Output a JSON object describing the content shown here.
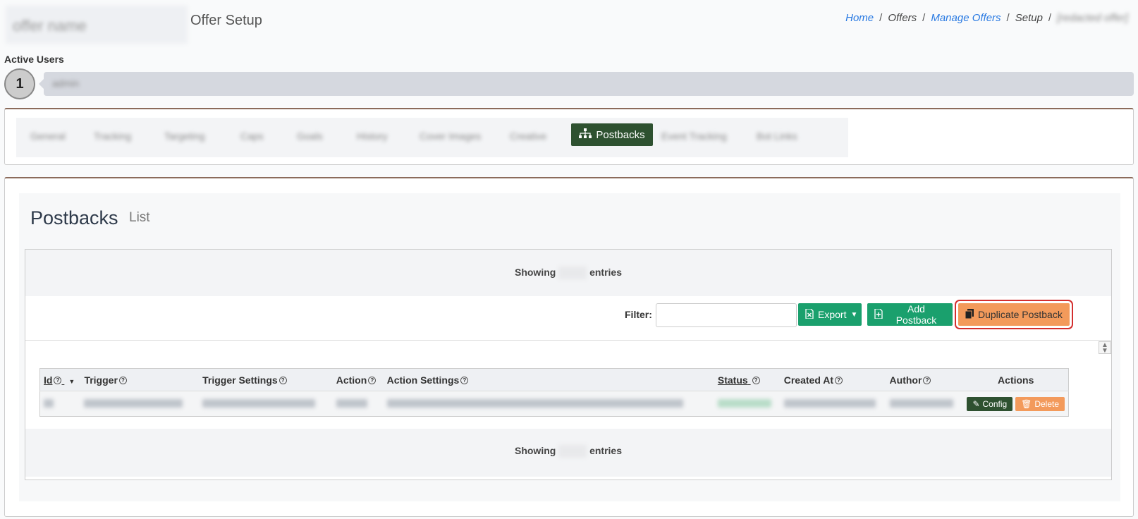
{
  "header": {
    "title": "Offer Setup",
    "breadcrumb": {
      "home": "Home",
      "offers": "Offers",
      "manage_offers": "Manage Offers",
      "setup": "Setup"
    }
  },
  "active_users": {
    "label": "Active Users",
    "count": "1"
  },
  "tabs": {
    "active_label": "Postbacks"
  },
  "main": {
    "title": "Postbacks",
    "subtitle": "List"
  },
  "table": {
    "showing_prefix": "Showing",
    "showing_suffix": "entries",
    "filter_label": "Filter:",
    "filter_value": "",
    "export_label": "Export",
    "add_label": "Add Postback",
    "duplicate_label": "Duplicate Postback",
    "columns": {
      "id": "Id",
      "trigger": "Trigger",
      "trigger_settings": "Trigger Settings",
      "action": "Action",
      "action_settings": "Action Settings",
      "status": "Status",
      "created_at": "Created At",
      "author": "Author",
      "actions": "Actions"
    },
    "row_actions": {
      "config": "Config",
      "delete": "Delete"
    }
  },
  "colors": {
    "primary_green": "#1aa06d",
    "dark_green": "#2e5130",
    "orange": "#f39a5b",
    "highlight_red": "#d32f2f",
    "link_blue": "#2a7ae2"
  }
}
